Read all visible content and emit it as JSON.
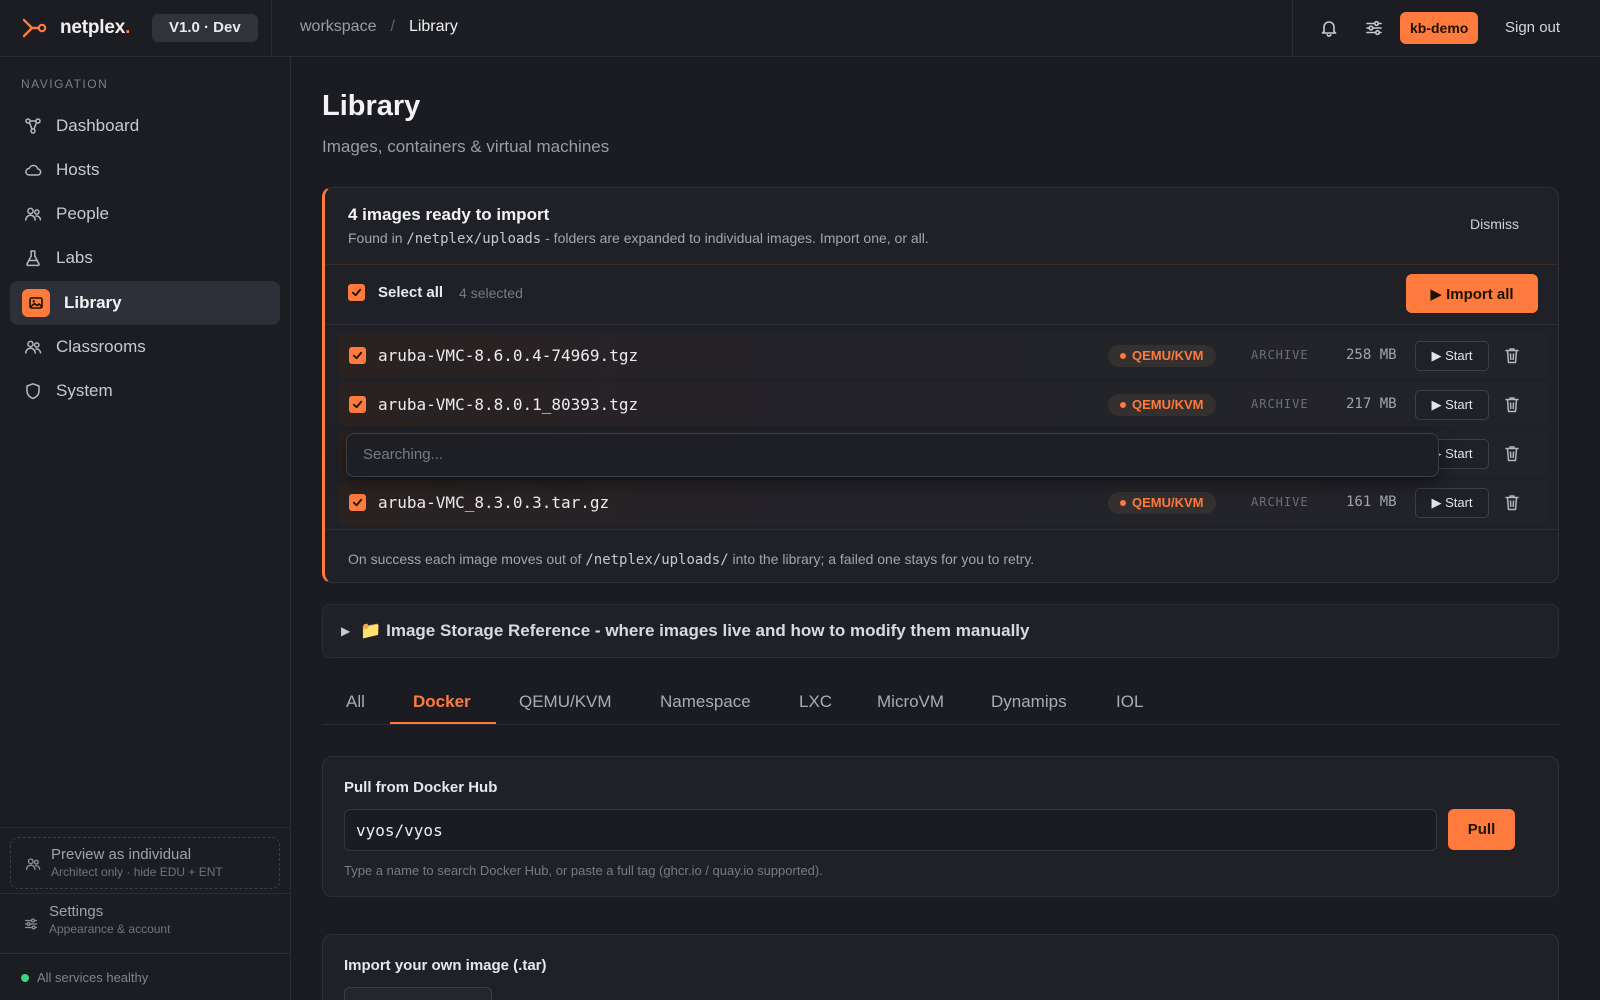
{
  "colors": {
    "accent": "#ff7a3d",
    "background": "#1a1c21",
    "healthy": "#3fd37a"
  },
  "header": {
    "brand_name": "netplex",
    "brand_dot": ".",
    "version": "V1.0 · Dev",
    "breadcrumb": [
      "workspace",
      "/",
      "Library"
    ],
    "icons": [
      "bell-icon",
      "sliders-icon"
    ],
    "user": "kb-demo",
    "sign_out": "Sign out"
  },
  "sidebar": {
    "heading": "NAVIGATION",
    "items": [
      {
        "label": "Dashboard",
        "icon": "network-icon",
        "active": false
      },
      {
        "label": "Hosts",
        "icon": "cloud-icon",
        "active": false
      },
      {
        "label": "People",
        "icon": "people-icon",
        "active": false
      },
      {
        "label": "Labs",
        "icon": "flask-icon",
        "active": false
      },
      {
        "label": "Library",
        "icon": "image-icon",
        "active": true
      },
      {
        "label": "Classrooms",
        "icon": "people-icon",
        "active": false
      },
      {
        "label": "System",
        "icon": "shield-icon",
        "active": false
      }
    ],
    "preview": {
      "title": "Preview as individual",
      "subtitle": "Architect only · hide EDU + ENT"
    },
    "settings": {
      "title": "Settings",
      "subtitle": "Appearance & account"
    },
    "health": "All services healthy"
  },
  "page": {
    "title": "Library",
    "subtitle": "Images, containers & virtual machines"
  },
  "import_panel": {
    "title": "4 images ready to import",
    "desc_prefix": "Found in ",
    "desc_path": "/netplex/uploads",
    "desc_suffix": " - folders are expanded to individual images. Import one, or all.",
    "dismiss": "Dismiss",
    "select_all": "Select all",
    "selected_count": "4 selected",
    "import_all": "▶ Import all",
    "files": [
      {
        "name": "aruba-VMC-8.6.0.4-74969.tgz",
        "type": "QEMU/KVM",
        "kind": "ARCHIVE",
        "size": "258 MB",
        "start": "▶ Start",
        "checked": true
      },
      {
        "name": "aruba-VMC-8.8.0.1_80393.tgz",
        "type": "QEMU/KVM",
        "kind": "ARCHIVE",
        "size": "217 MB",
        "start": "▶ Start",
        "checked": true
      },
      {
        "name": "",
        "type": "",
        "kind": "",
        "size": "",
        "start": "▶ Start",
        "checked": true
      },
      {
        "name": "aruba-VMC_8.3.0.3.tar.gz",
        "type": "QEMU/KVM",
        "kind": "ARCHIVE",
        "size": "161 MB",
        "start": "▶ Start",
        "checked": true
      }
    ],
    "search_placeholder": "Searching...",
    "footer_prefix": "On success each image moves out of ",
    "footer_path": "/netplex/uploads/",
    "footer_suffix": " into the library; a failed one stays for you to retry."
  },
  "storage_reference": {
    "caret": "▶",
    "text": "📁 Image Storage Reference - where images live and how to modify them manually"
  },
  "tabs": [
    "All",
    "Docker",
    "QEMU/KVM",
    "Namespace",
    "LXC",
    "MicroVM",
    "Dynamips",
    "IOL"
  ],
  "active_tab": "Docker",
  "docker_pull": {
    "title": "Pull from Docker Hub",
    "value": "vyos/vyos",
    "button": "Pull",
    "hint": "Type a name to search Docker Hub, or paste a full tag (ghcr.io / quay.io supported)."
  },
  "own_image": {
    "title": "Import your own image (.tar)"
  }
}
